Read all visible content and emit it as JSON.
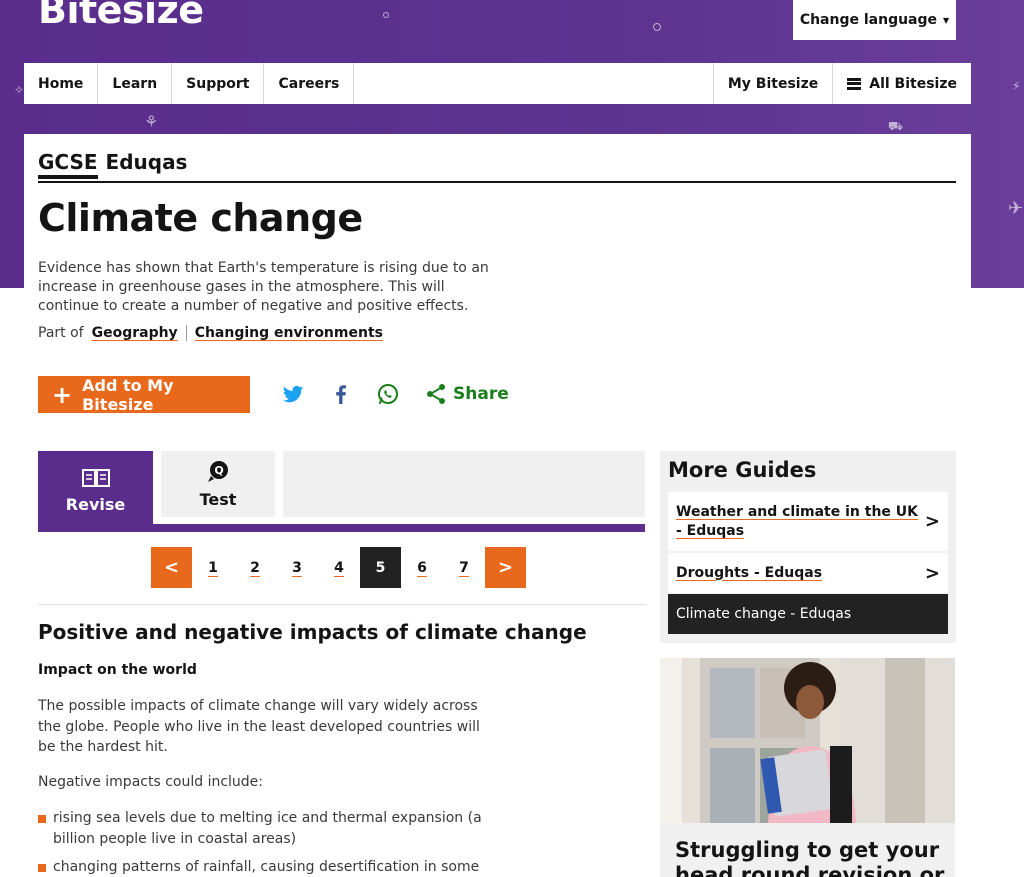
{
  "header": {
    "logo": "Bitesize",
    "change_language": "Change language"
  },
  "nav": {
    "left": [
      "Home",
      "Learn",
      "Support",
      "Careers"
    ],
    "my_bitesize": "My Bitesize",
    "all_bitesize": "All Bitesize"
  },
  "breadcrumb": {
    "level": "GCSE",
    "board": "Eduqas"
  },
  "page": {
    "title": "Climate change",
    "intro": "Evidence has shown that Earth's temperature is rising due to an increase in greenhouse gases in the atmosphere. This will continue to create a number of negative and positive effects.",
    "part_of_label": "Part of",
    "part_of_links": [
      "Geography",
      "Changing environments"
    ]
  },
  "actions": {
    "add_label": "Add to My Bitesize",
    "share_label": "Share"
  },
  "tabs": [
    {
      "label": "Revise",
      "active": true
    },
    {
      "label": "Test",
      "active": false
    }
  ],
  "pagination": {
    "prev": "<",
    "next": ">",
    "pages": [
      "1",
      "2",
      "3",
      "4",
      "5",
      "6",
      "7"
    ],
    "current": "5"
  },
  "article": {
    "heading": "Positive and negative impacts of climate change",
    "subheading": "Impact on the world",
    "para1": "The possible impacts of climate change will vary widely across the globe. People who live in the least developed countries will be the hardest hit.",
    "para2": "Negative impacts could include:",
    "bullets": [
      "rising sea levels due to melting ice and thermal expansion (a billion people live in coastal areas)",
      "changing patterns of rainfall, causing desertification in some"
    ]
  },
  "more_guides": {
    "title": "More Guides",
    "items": [
      {
        "label": "Weather and climate in the UK - Eduqas",
        "current": false
      },
      {
        "label": "Droughts - Eduqas",
        "current": false
      },
      {
        "label": "Climate change - Eduqas",
        "current": true
      }
    ]
  },
  "promo": {
    "text": "Struggling to get your head round revision or"
  },
  "colors": {
    "brand_purple": "#5a2d8c",
    "accent_orange": "#e8691b",
    "share_green": "#1a7e1a",
    "twitter_blue": "#1da1f2",
    "facebook_blue": "#3b5998"
  }
}
